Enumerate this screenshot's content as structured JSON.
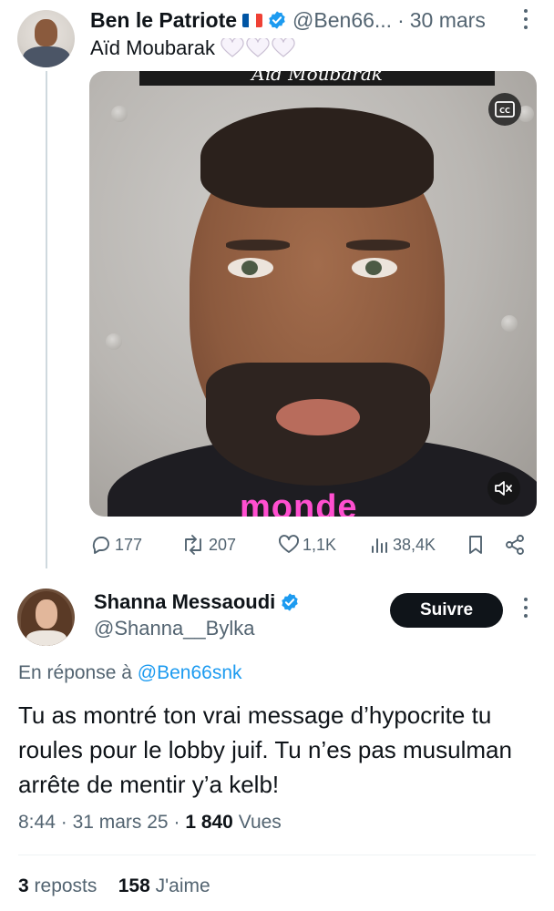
{
  "tweet": {
    "author_name": "Ben le Patriote",
    "author_handle": "@Ben66...",
    "separator": "·",
    "date": "30 mars",
    "text": "Aïd Moubarak",
    "video": {
      "top_caption": "Aïd Moubarak",
      "bottom_caption": "monde",
      "cc_label": "CC"
    },
    "actions": {
      "replies": "177",
      "reposts": "207",
      "likes": "1,1K",
      "views": "38,4K"
    }
  },
  "reply": {
    "author_name": "Shanna Messaoudi",
    "author_handle": "@Shanna__Bylka",
    "follow_label": "Suivre",
    "reply_to_prefix": "En réponse à",
    "reply_to_handle": "@Ben66snk",
    "text": "Tu as montré ton vrai message d’hypocrite tu roules pour le lobby juif. Tu n’es pas musulman arrête de mentir y’a kelb!",
    "time": "8:44",
    "sep1": "·",
    "date": "31 mars 25",
    "sep2": "·",
    "views_count": "1 840",
    "views_label": "Vues",
    "reposts_count": "3",
    "reposts_label": "reposts",
    "likes_count": "158",
    "likes_label": "J'aime"
  },
  "colors": {
    "verified": "#1d9bf0",
    "link": "#1d9bf0",
    "muted": "#536471",
    "text": "#0f1419",
    "follow_bg": "#0f1419",
    "caption": "#ff4fd0"
  }
}
